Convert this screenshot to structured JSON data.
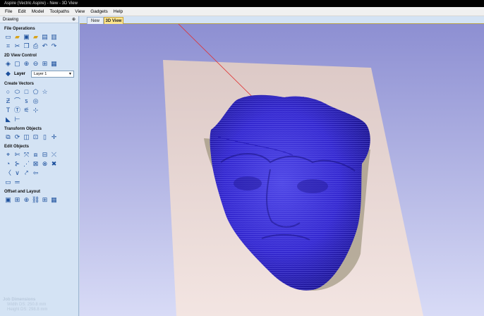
{
  "app": {
    "title": "Aspire (Vectric Aspire) - New - 3D View"
  },
  "menu": [
    "File",
    "Edit",
    "Model",
    "Toolpaths",
    "View",
    "Gadgets",
    "Help"
  ],
  "sidebar": {
    "title": "Drawing",
    "sections": {
      "file_operations": "File Operations",
      "view_control": "2D View Control",
      "create_vectors": "Create Vectors",
      "transform_objects": "Transform Objects",
      "edit_objects": "Edit Objects",
      "offset_layout": "Offset and Layout"
    },
    "layer": {
      "label": "Layer",
      "value": "Layer 1"
    },
    "job_dimensions": {
      "header": "Job Dimensions",
      "width_label": "Width",
      "width_value": "DS: 250.8 mm",
      "height_label": "Height",
      "height_value": "DS: 298.8 mm"
    }
  },
  "tabs": [
    {
      "label": "New",
      "active": false
    },
    {
      "label": "3D View",
      "active": true
    }
  ],
  "colors": {
    "viewport_top": "#8d8fd2",
    "viewport_bottom": "#d8dbf6",
    "material": "#ecdad7",
    "mesh": "#3a2ee0",
    "accent_tab": "#fde58e"
  },
  "icons": {
    "file_operations": [
      "new-file-icon",
      "open-file-icon",
      "save-icon",
      "open-folder-icon",
      "save-as-icon",
      "import-icon",
      "cut-icon",
      "copy-icon",
      "paste-icon",
      "print-icon",
      "undo-icon",
      "redo-icon"
    ],
    "view_control": [
      "zoom-extents-icon",
      "zoom-box-icon",
      "zoom-in-icon",
      "zoom-out-icon",
      "pan-icon",
      "grid-icon"
    ],
    "create_vectors": [
      "circle-icon",
      "ellipse-icon",
      "rectangle-icon",
      "polygon-icon",
      "star-icon",
      "polyline-icon",
      "curve-icon",
      "spiral-icon",
      "bezier-icon",
      "arc-icon",
      "text-icon",
      "text-on-curve-icon",
      "dimension-icon",
      "image-trace-icon",
      "angle-icon",
      "measure-icon"
    ],
    "transform_objects": [
      "move-icon",
      "rotate-icon",
      "mirror-icon",
      "scale-icon",
      "align-icon",
      "center-icon"
    ],
    "edit_objects": [
      "node-edit-icon",
      "trim-icon",
      "join-icon",
      "weld-icon",
      "subtract-icon",
      "intersect-icon",
      "fillet-icon",
      "extend-icon",
      "smooth-icon",
      "close-icon",
      "back-icon",
      "forward-icon",
      "shape-icon",
      "split-icon",
      "reflect-icon",
      "link-icon",
      "box-icon",
      "lines-icon"
    ],
    "offset_layout": [
      "offset-icon",
      "array-icon",
      "nest-icon",
      "group-icon",
      "ungroup-icon",
      "layout-icon"
    ]
  }
}
